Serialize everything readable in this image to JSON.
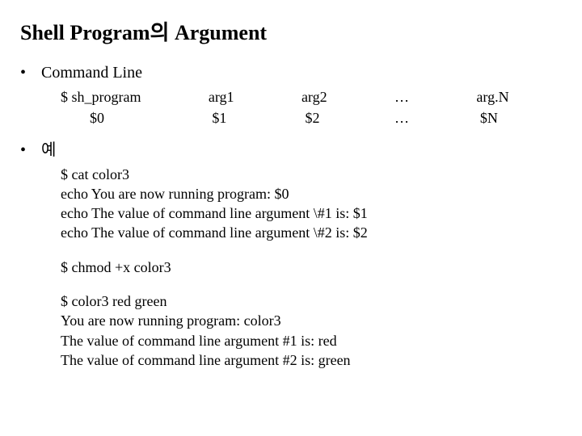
{
  "title": "Shell Program의 Argument",
  "section1": {
    "label": "Command Line",
    "row1": {
      "c1": "$ sh_program",
      "c2": "arg1",
      "c3": "arg2",
      "c4": "…",
      "c5": "arg.N"
    },
    "row2": {
      "c1": "        $0",
      "c2": " $1",
      "c3": " $2",
      "c4": "…",
      "c5": " $N"
    }
  },
  "section2": {
    "label": "예",
    "block1": {
      "l1": "$ cat color3",
      "l2": "echo You are now running program: $0",
      "l3": "echo The value of command line argument \\#1 is: $1",
      "l4": "echo The value of command line argument \\#2 is: $2"
    },
    "block2": {
      "l1": "$ chmod +x color3"
    },
    "block3": {
      "l1": "$ color3 red green",
      "l2": "You are now running program: color3",
      "l3": "The value of command line argument #1 is: red",
      "l4": "The value of command line argument #2 is: green"
    }
  }
}
